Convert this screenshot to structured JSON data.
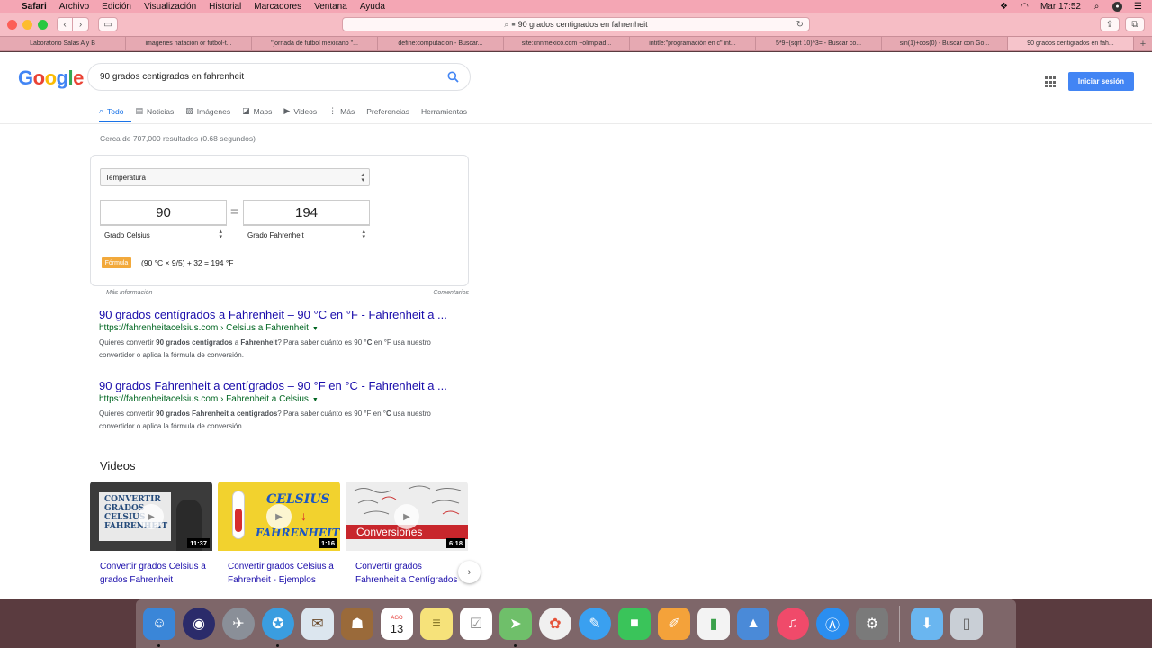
{
  "menubar": {
    "app": "Safari",
    "items": [
      "Archivo",
      "Edición",
      "Visualización",
      "Historial",
      "Marcadores",
      "Ventana",
      "Ayuda"
    ],
    "clock": "Mar 17:52"
  },
  "toolbar": {
    "address": "90 grados centigrados en fahrenheit"
  },
  "tabs": [
    "Laboratorio Salas A y B",
    "imagenes natacion or futbol-t...",
    "\"jornada de futbol mexicano \"...",
    "define:computacion - Buscar...",
    "site:cnnmexico.com ~olimpiad...",
    "intitle:\"programación en c\" int...",
    "5*9+(sqrt 10)^3= - Buscar co...",
    "sin(1)+cos(0) - Buscar con Go...",
    "90 grados centigrados en fah..."
  ],
  "google": {
    "logo": [
      "G",
      "o",
      "o",
      "g",
      "l",
      "e"
    ],
    "query": "90 grados centigrados en fahrenheit",
    "signin": "Iniciar sesión",
    "nav": {
      "todo": "Todo",
      "noticias": "Noticias",
      "imagenes": "Imágenes",
      "maps": "Maps",
      "videos": "Videos",
      "mas": "Más",
      "preferencias": "Preferencias",
      "herramientas": "Herramientas"
    },
    "result_count": "Cerca de 707,000 resultados (0.68 segundos)"
  },
  "converter": {
    "category": "Temperatura",
    "from_value": "90",
    "from_unit": "Grado Celsius",
    "to_value": "194",
    "to_unit": "Grado Fahrenheit",
    "equals": "=",
    "formula_label": "Fórmula",
    "formula": "(90 °C × 9/5) + 32 = 194 °F",
    "more_info": "Más información",
    "feedback": "Comentarios"
  },
  "results": [
    {
      "title": "90 grados centígrados a Fahrenheit – 90 °C en °F - Fahrenheit a ...",
      "url": "https://fahrenheitacelsius.com › Celsius a Fahrenheit",
      "snippet_1": "Quieres convertir ",
      "snippet_b1": "90 grados centigrados",
      "snippet_2": " a ",
      "snippet_b2": "Fahrenheit",
      "snippet_3": "? Para saber cuánto es 90 °",
      "snippet_b3": "C",
      "snippet_4": " en °F usa nuestro convertidor o aplica la fórmula de conversión."
    },
    {
      "title": "90 grados Fahrenheit a centígrados – 90 °F en °C - Fahrenheit a ...",
      "url": "https://fahrenheitacelsius.com › Fahrenheit a Celsius",
      "snippet_1": "Quieres convertir ",
      "snippet_b1": "90 grados Fahrenheit a centigrados",
      "snippet_2": "? Para saber cuánto es 90 °F en °",
      "snippet_b2": "C",
      "snippet_3": " usa nuestro convertidor o aplica la fórmula de conversión."
    }
  ],
  "videos": {
    "heading": "Videos",
    "items": [
      {
        "title": "Convertir grados Celsius a grados Fahrenheit",
        "duration": "11:37",
        "thumb_text": "CONVERTIR GRADOS CELSIUS FAHRENHEIT"
      },
      {
        "title": "Convertir grados Celsius a Fahrenheit - Ejemplos",
        "duration": "1:16",
        "thumb_text_1": "CELSIUS",
        "thumb_text_2": "FAHRENHEIT"
      },
      {
        "title": "Convertir grados Fahrenheit a Centígrados",
        "duration": "6:18",
        "thumb_text": "Conversiones"
      }
    ]
  },
  "dock": {
    "calendar_month": "AGO",
    "calendar_day": "13"
  }
}
